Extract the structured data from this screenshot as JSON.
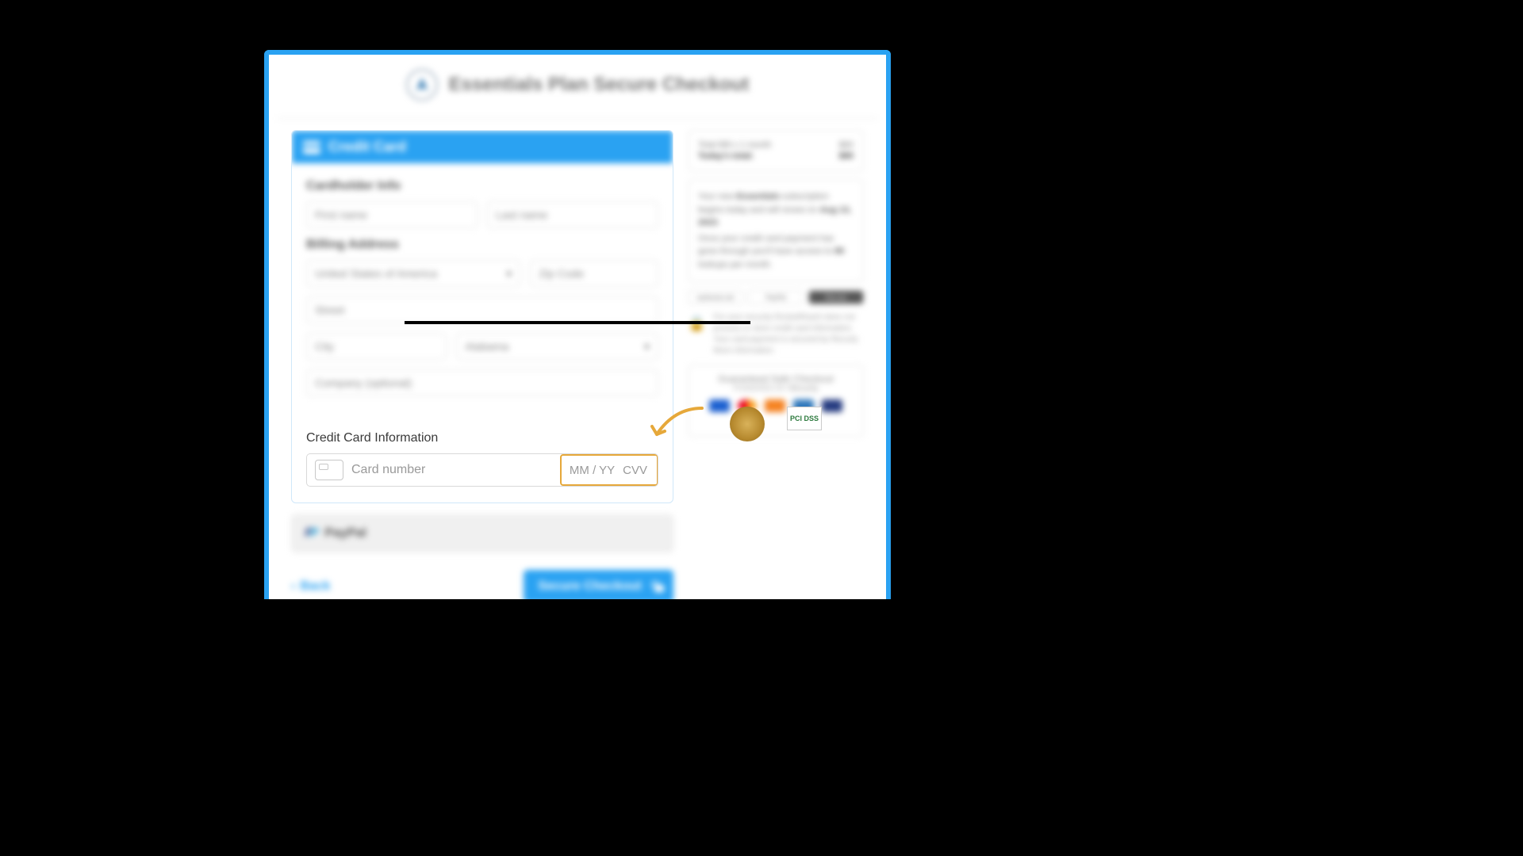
{
  "header": {
    "title": "Essentials Plan Secure Checkout"
  },
  "credit_card": {
    "panel_title": "Credit Card",
    "cardholder_section": "Cardholder Info",
    "first_name_ph": "First name",
    "last_name_ph": "Last name",
    "billing_section": "Billing Address",
    "country_value": "United States of America",
    "zip_ph": "Zip Code",
    "street_ph": "Street",
    "city_ph": "City",
    "state_value": "Alabama",
    "company_ph": "Company (optional)",
    "cc_info_label": "Credit Card Information",
    "card_number_ph": "Card number",
    "expiry_ph": "MM / YY",
    "cvv_ph": "CVV"
  },
  "paypal": {
    "label": "PayPal"
  },
  "footer": {
    "back": "Back",
    "checkout": "Secure Checkout"
  },
  "summary": {
    "row1_label": "Total Bill x 1 month",
    "row1_value": "$80",
    "row2_label": "Today's total:",
    "row2_value": "$80"
  },
  "messages": {
    "line1a": "Your new ",
    "plan": "Essentials",
    "line1b": " subscription begins today and will renew on ",
    "date": "Aug 13, 2023",
    "line2a": "Once your credit card payment has gone through you'll have access to ",
    "lookups": "80",
    "line2b": " lookups per month."
  },
  "badges": {
    "b1": "authorize.net",
    "b2": "PayPal",
    "b3": "Recurly"
  },
  "security_note": "For your security RocketReach does not process or store credit card information. Your card payment is secured by Recurly. More information.",
  "guarantee": {
    "title": "Guaranteed Safe Checkout",
    "by_label": "POWERED BY",
    "by": "Recurly",
    "seal2_text": "PCI DSS"
  }
}
